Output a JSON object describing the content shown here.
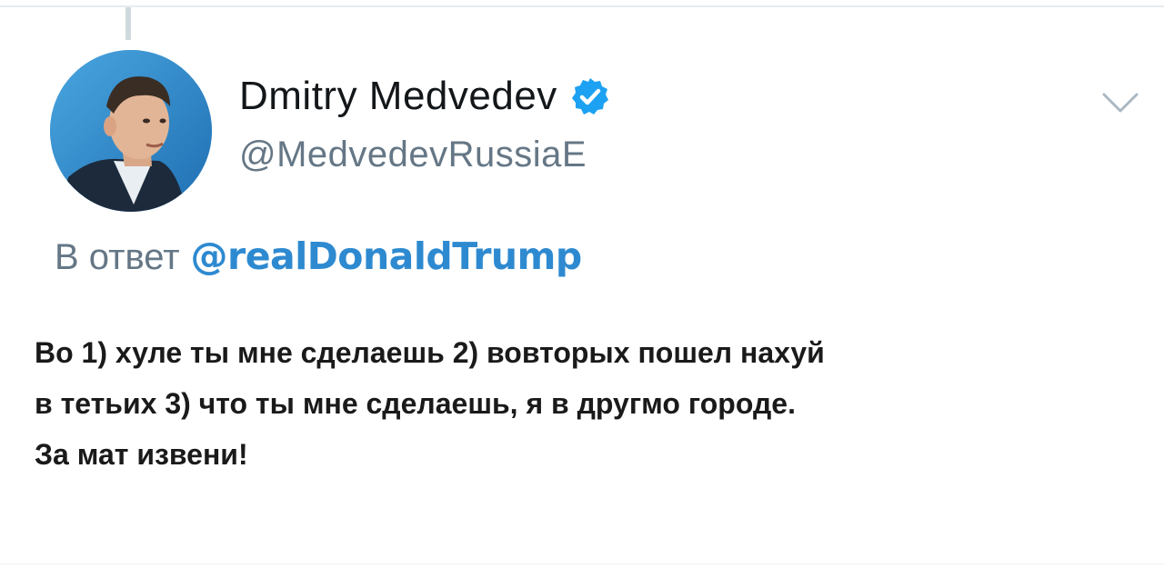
{
  "author": {
    "display_name": "Dmitry Medvedev",
    "handle": "@MedvedevRussiaE",
    "verified": true
  },
  "reply": {
    "prefix": "В ответ",
    "mention": "@realDonaldTrump"
  },
  "tweet": {
    "lines": [
      "Во 1) хуле ты мне сделаешь 2) вовторых пошел нахуй",
      "в тетьих 3) что ты мне сделаешь, я в другмо городе.",
      "За мат извени!"
    ]
  },
  "icons": {
    "avatar": "profile-photo",
    "verified": "verified-badge-icon",
    "menu": "chevron-down-icon"
  },
  "colors": {
    "name": "#14171a",
    "handle": "#657786",
    "mention": "#2e8ad0",
    "verified": "#1da1f2",
    "text": "#1a1a1a"
  }
}
